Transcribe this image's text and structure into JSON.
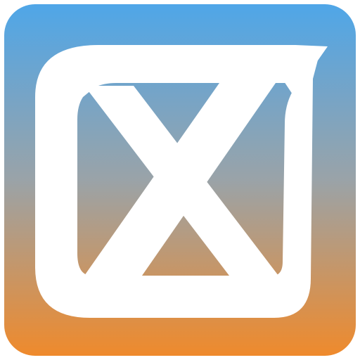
{
  "app_icon": {
    "icon_name": "x-box-logo-icon",
    "colors": {
      "gradient_top": "#4fa6e8",
      "gradient_mid": "#9aa3a8",
      "gradient_bottom": "#ef8a2c",
      "mark": "#ffffff"
    }
  }
}
